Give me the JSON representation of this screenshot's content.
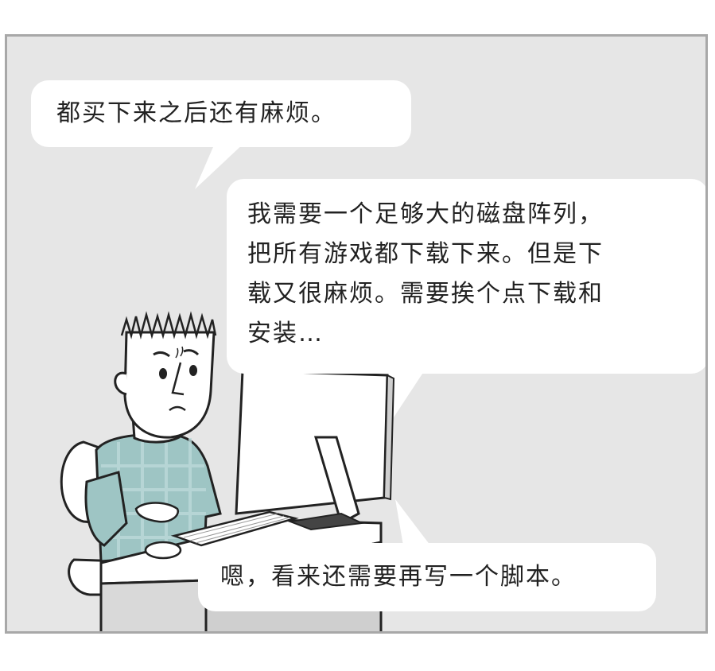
{
  "comic_panel": {
    "bubbles": [
      {
        "text": "都买下来之后还有麻烦。"
      },
      {
        "text": "我需要一个足够大的磁盘阵列，\n把所有游戏都下载下来。但是下\n载又很麻烦。需要挨个点下载和\n安装…"
      },
      {
        "text": "嗯，看来还需要再写一个脚本。"
      }
    ]
  },
  "colors": {
    "background": "#e6e6e6",
    "border": "#a8a8a8",
    "bubble": "#ffffff",
    "shirt": "#9ec5c4",
    "line": "#222222"
  }
}
